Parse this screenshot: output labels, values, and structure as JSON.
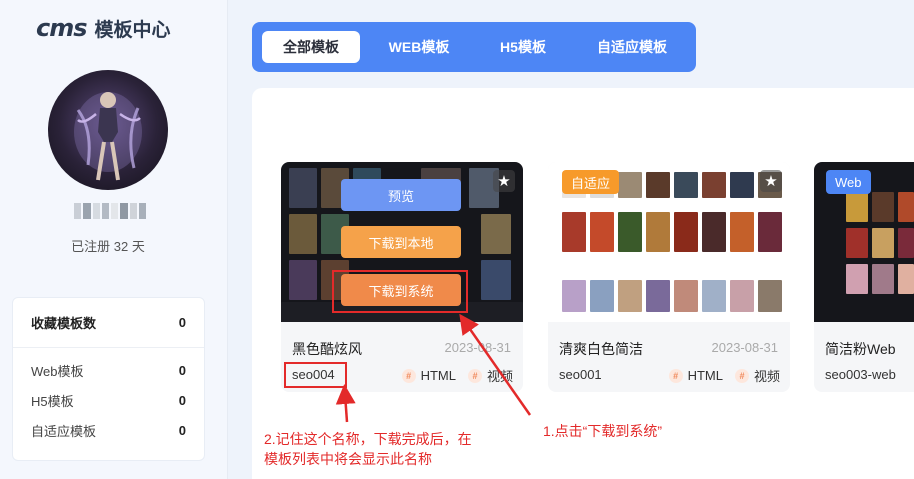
{
  "sidebar": {
    "logo_mark": "cms",
    "logo_title": "模板中心",
    "registered": "已注册 32 天",
    "stats_title": "收藏模板数",
    "stats_total": "0",
    "stats_rows": [
      {
        "label": "Web模板",
        "value": "0"
      },
      {
        "label": "H5模板",
        "value": "0"
      },
      {
        "label": "自适应模板",
        "value": "0"
      }
    ]
  },
  "tabs": [
    "全部模板",
    "WEB模板",
    "H5模板",
    "自适应模板"
  ],
  "cards": [
    {
      "title": "黑色酷炫风",
      "date": "2023-08-31",
      "code": "seo004",
      "tags": [
        "HTML",
        "视频"
      ],
      "overlay_buttons": [
        "预览",
        "下载到本地",
        "下载到系统"
      ]
    },
    {
      "title": "清爽白色简洁",
      "date": "2023-08-31",
      "code": "seo001",
      "tags": [
        "HTML",
        "视频"
      ],
      "badge": "自适应"
    },
    {
      "title": "简洁粉Web",
      "code": "seo003-web",
      "badge": "Web"
    }
  ],
  "annotations": {
    "note_left_line1": "2.记住这个名称，下载完成后，在",
    "note_left_line2": "模板列表中将会显示此名称",
    "note_right": "1.点击“下载到系统”"
  },
  "colors": {
    "primary": "#4d86f5",
    "preview_btn": "#6d96f3",
    "download_btn": "#f5a24a",
    "badge_orange": "#f79a2a",
    "badge_blue": "#4d86f5",
    "annotation_red": "#e32a2a"
  }
}
